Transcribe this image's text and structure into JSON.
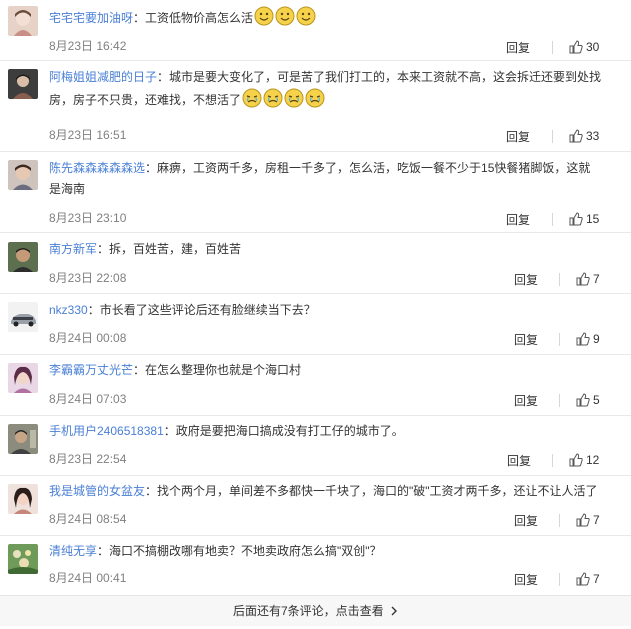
{
  "comments": [
    {
      "name": "宅宅宅要加油呀",
      "text": "：工资低物价高怎么活",
      "emoji": "smile-emoji",
      "emoji_count": 3,
      "date": "8月23日 16:42",
      "reply": "回复",
      "likes": "30"
    },
    {
      "name": "阿梅姐姐减肥的日子",
      "text": "：城市是要大变化了，可是苦了我们打工的，本来工资就不高，这会拆迁还要到处找",
      "text2": "房，房子不只贵，还难找，不想活了",
      "emoji": "crying-emoji",
      "emoji_count": 4,
      "date": "8月23日 16:51",
      "reply": "回复",
      "likes": "33"
    },
    {
      "name": "陈先森森森森森选",
      "text": "：麻痹，工资两千多，房租一千多了，怎么活，吃饭一餐不少于15快餐猪脚饭，这就",
      "text2": "是海南",
      "date": "8月23日 23:10",
      "reply": "回复",
      "likes": "15"
    },
    {
      "name": "南方新军",
      "text": "：拆，百姓苦，建，百姓苦",
      "date": "8月23日 22:08",
      "reply": "回复",
      "likes": "7"
    },
    {
      "name": "nkz330",
      "text": "：市长看了这些评论后还有脸继续当下去？",
      "date": "8月24日 00:08",
      "reply": "回复",
      "likes": "9"
    },
    {
      "name": "李霸霸万丈光芒",
      "text": "：在怎么整理你也就是个海口村",
      "date": "8月24日 07:03",
      "reply": "回复",
      "likes": "5"
    },
    {
      "name": "手机用户2406518381",
      "text": "：政府是要把海口搞成没有打工仔的城市了。",
      "date": "8月23日 22:54",
      "reply": "回复",
      "likes": "12"
    },
    {
      "name": "我是城管的女盆友",
      "text": "：找个两个月，单间差不多都快一千块了，海口的\"破\"工资才两千多，还让不让人活了",
      "date": "8月24日 08:54",
      "reply": "回复",
      "likes": "7"
    },
    {
      "name": "清纯无享",
      "text": "：海口不搞棚改哪有地卖？不地卖政府怎么搞\"双创\"？",
      "date": "8月24日 00:41",
      "reply": "回复",
      "likes": "7"
    }
  ],
  "footer": {
    "more_text": "后面还有7条评论，点击查看",
    "chevron": "chevron-right-icon"
  },
  "colors": {
    "name": "#4a7fd6",
    "meta": "#808080",
    "text": "#333333",
    "divider": "#e9e9e9",
    "footer_bg": "#f7f7f7"
  }
}
